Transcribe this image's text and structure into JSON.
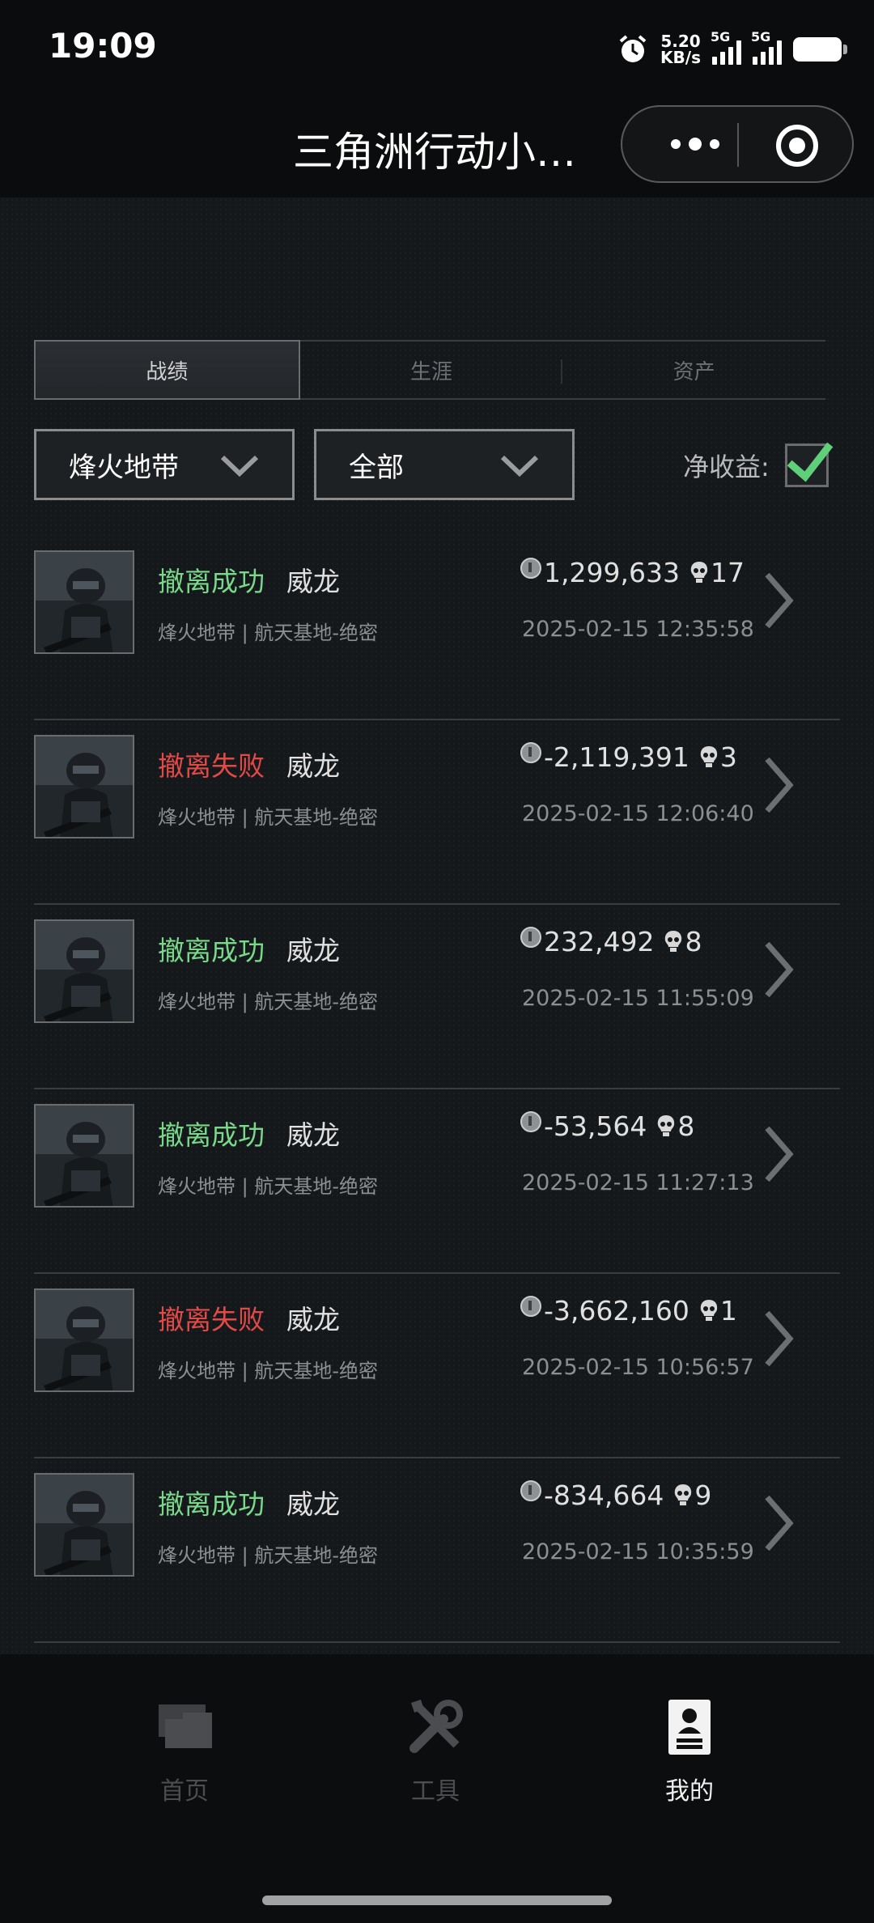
{
  "status_bar": {
    "time": "19:09",
    "net_speed_value": "5.20",
    "net_speed_unit": "KB/s",
    "sim1_label": "5G",
    "sim2_label": "5G"
  },
  "nav": {
    "title": "三角洲行动小…",
    "more_icon": "more-dots-icon",
    "close_icon": "target-circle-icon"
  },
  "tabs": [
    {
      "label": "战绩",
      "active": true
    },
    {
      "label": "生涯",
      "active": false
    },
    {
      "label": "资产",
      "active": false
    }
  ],
  "filters": {
    "mode": "烽火地带",
    "scope": "全部",
    "net_label": "净收益:",
    "net_checked": true
  },
  "records": [
    {
      "status": "撤离成功",
      "ok": true,
      "operator": "威龙",
      "map": "烽火地带 | 航天基地-绝密",
      "value": "1,299,633",
      "kills": "17",
      "time": "2025-02-15 12:35:58"
    },
    {
      "status": "撤离失败",
      "ok": false,
      "operator": "威龙",
      "map": "烽火地带 | 航天基地-绝密",
      "value": "-2,119,391",
      "kills": "3",
      "time": "2025-02-15 12:06:40"
    },
    {
      "status": "撤离成功",
      "ok": true,
      "operator": "威龙",
      "map": "烽火地带 | 航天基地-绝密",
      "value": "232,492",
      "kills": "8",
      "time": "2025-02-15 11:55:09"
    },
    {
      "status": "撤离成功",
      "ok": true,
      "operator": "威龙",
      "map": "烽火地带 | 航天基地-绝密",
      "value": "-53,564",
      "kills": "8",
      "time": "2025-02-15 11:27:13"
    },
    {
      "status": "撤离失败",
      "ok": false,
      "operator": "威龙",
      "map": "烽火地带 | 航天基地-绝密",
      "value": "-3,662,160",
      "kills": "1",
      "time": "2025-02-15 10:56:57"
    },
    {
      "status": "撤离成功",
      "ok": true,
      "operator": "威龙",
      "map": "烽火地带 | 航天基地-绝密",
      "value": "-834,664",
      "kills": "9",
      "time": "2025-02-15 10:35:59"
    }
  ],
  "bottom_nav": [
    {
      "label": "首页",
      "icon": "folder-icon",
      "active": false
    },
    {
      "label": "工具",
      "icon": "tools-icon",
      "active": false
    },
    {
      "label": "我的",
      "icon": "profile-card-icon",
      "active": true
    }
  ],
  "colors": {
    "success": "#79d88a",
    "fail": "#e24a48",
    "check": "#5fd07a"
  }
}
